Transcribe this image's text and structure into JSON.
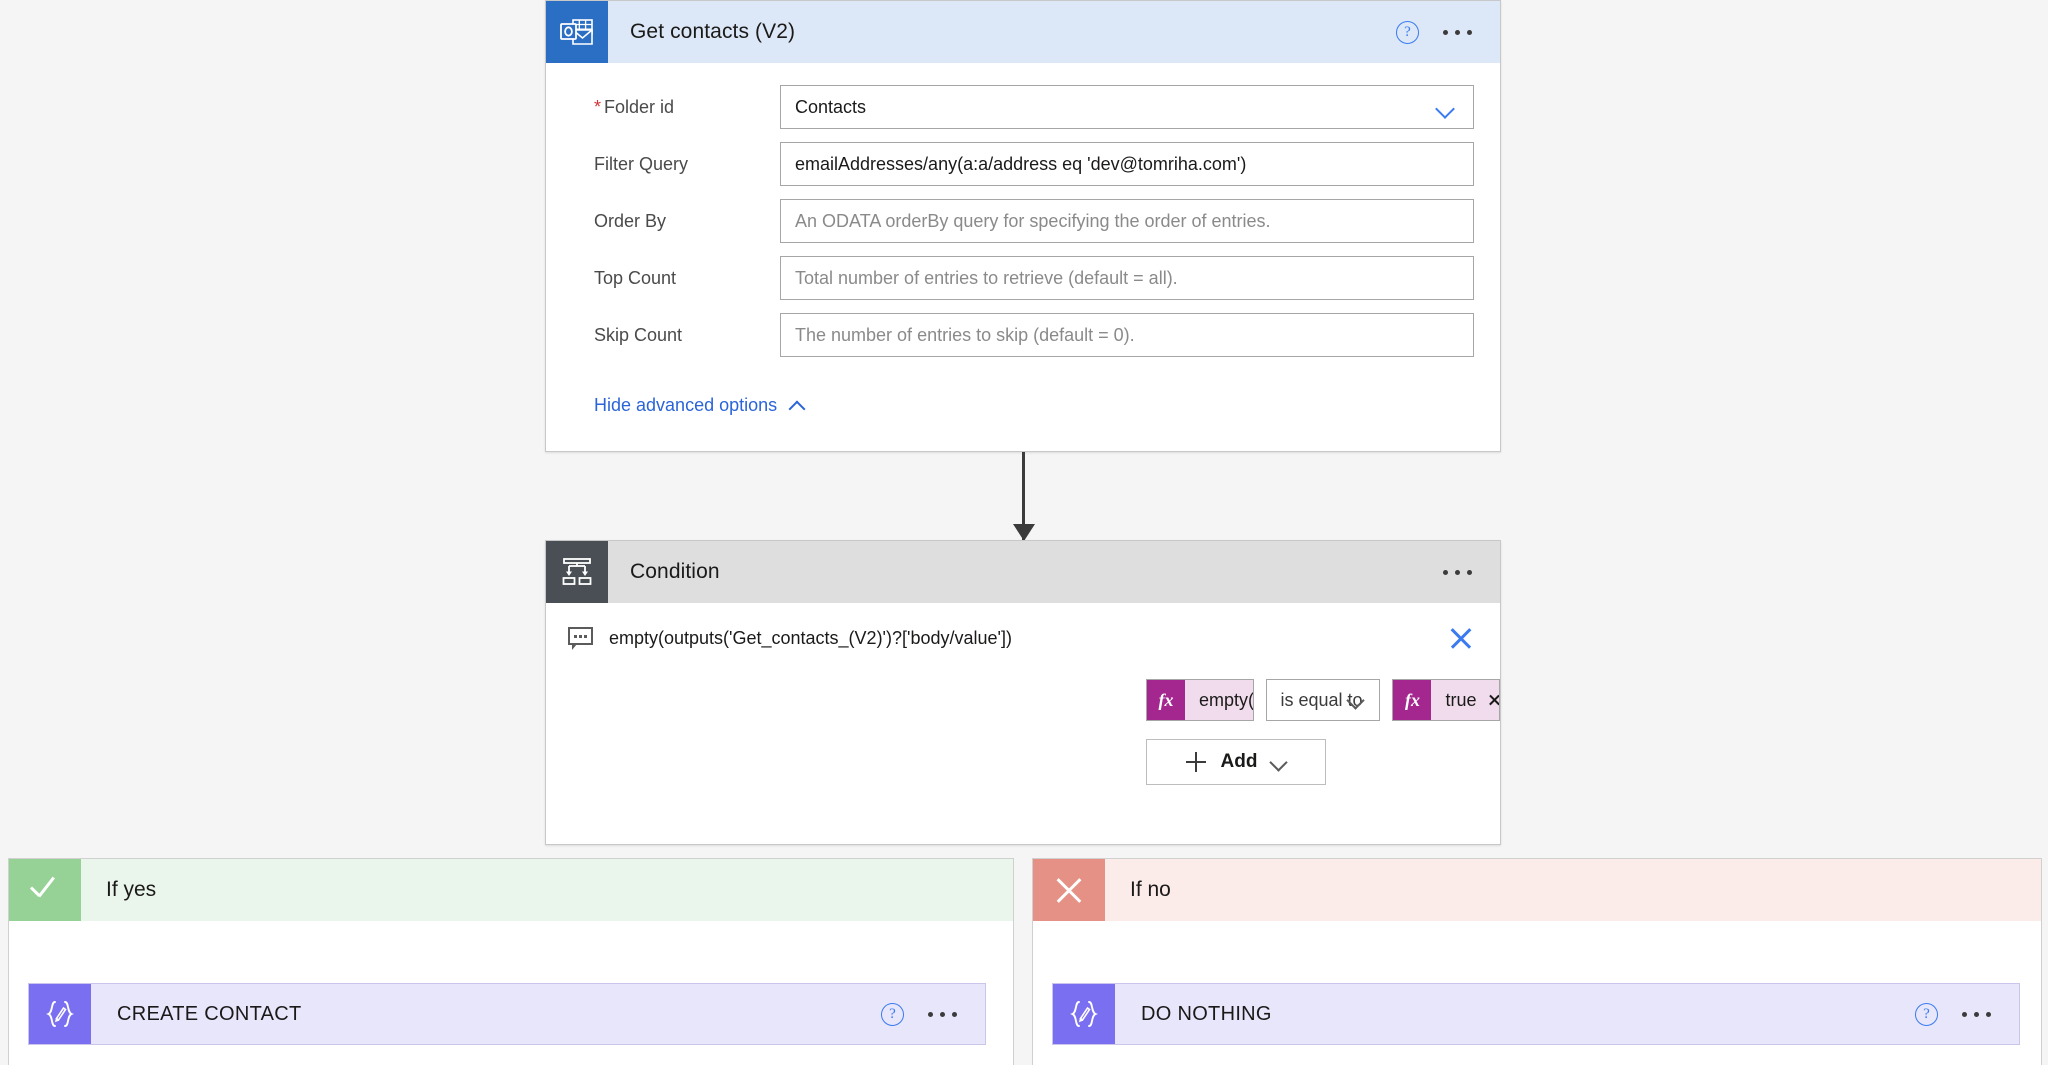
{
  "app": {
    "canvas_bg": "#f5f5f5"
  },
  "colors": {
    "outlook_blue": "#2b6fc4",
    "condition_grey": "#4a4f55",
    "accent_blue": "#3a7bf0",
    "link_blue": "#2b64d9",
    "fx_magenta": "#a4268f",
    "token_pink": "#f0dcec",
    "yes_green": "#96d296",
    "no_red": "#e59185",
    "action_purple": "#7a6ff0"
  },
  "get_contacts": {
    "title": "Get contacts (V2)",
    "icon": "outlook-icon",
    "help_icon": "help-icon",
    "menu_icon": "ellipsis-icon",
    "fields": [
      {
        "label": "Folder id",
        "required": true,
        "value": "Contacts",
        "is_placeholder": false,
        "control": "dropdown",
        "chevron": "chevron-down-icon"
      },
      {
        "label": "Filter Query",
        "required": false,
        "value": "emailAddresses/any(a:a/address eq 'dev@tomriha.com')",
        "is_placeholder": false,
        "control": "text"
      },
      {
        "label": "Order By",
        "required": false,
        "value": "An ODATA orderBy query for specifying the order of entries.",
        "is_placeholder": true,
        "control": "text"
      },
      {
        "label": "Top Count",
        "required": false,
        "value": "Total number of entries to retrieve (default = all).",
        "is_placeholder": true,
        "control": "text"
      },
      {
        "label": "Skip Count",
        "required": false,
        "value": "The number of entries to skip (default = 0).",
        "is_placeholder": true,
        "control": "text"
      }
    ],
    "advanced_options_link": "Hide advanced options"
  },
  "condition": {
    "title": "Condition",
    "icon": "condition-branch-icon",
    "menu_icon": "ellipsis-icon",
    "expression_comment": "empty(outputs('Get_contacts_(V2)')?['body/value'])",
    "comment_icon": "comment-icon",
    "close_icon": "close-icon",
    "row": {
      "left_token": {
        "fx": "fx",
        "text": "empty(...)",
        "remove": "remove-icon"
      },
      "operator": "is equal to",
      "right_token": {
        "fx": "fx",
        "text": "true",
        "remove": "remove-icon"
      }
    },
    "add_button": {
      "label": "Add",
      "plus_icon": "plus-icon",
      "chevron": "chevron-down-icon"
    }
  },
  "branches": {
    "yes": {
      "label": "If yes",
      "icon": "check-icon",
      "action": {
        "title": "CREATE CONTACT",
        "icon": "scope-compose-icon",
        "help_icon": "help-icon",
        "menu_icon": "ellipsis-icon"
      }
    },
    "no": {
      "label": "If no",
      "icon": "cross-icon",
      "action": {
        "title": "DO NOTHING",
        "icon": "scope-compose-icon",
        "help_icon": "help-icon",
        "menu_icon": "ellipsis-icon"
      }
    }
  }
}
